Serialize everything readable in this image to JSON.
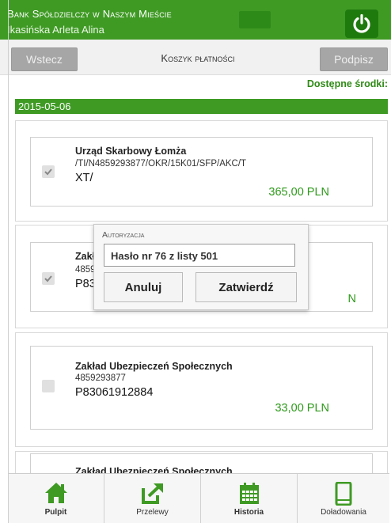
{
  "header": {
    "bank_name": "Bank Spółdzielczy w Naszym Mieście",
    "user_name": "Ikasińska Arleta Alina",
    "logout_icon": "power-icon"
  },
  "toolbar": {
    "back_label": "Wstecz",
    "title": "Koszyk płatności",
    "sign_label": "Podpisz"
  },
  "funds_label": "Dostępne środki:",
  "date": "2015-05-06",
  "payments": [
    {
      "payee": "Urząd Skarbowy Łomża",
      "account": "/TI/N4859293877/OKR/15K01/SFP/AKC/T",
      "reference": "XT/",
      "amount": "365,00 PLN",
      "checked": true
    },
    {
      "payee": "Zakła",
      "account": "4859",
      "reference": "P830",
      "amount": "N",
      "checked": true
    },
    {
      "payee": "Zakład Ubezpieczeń Społecznych",
      "account": "4859293877",
      "reference": "P83061912884",
      "amount": "33,00 PLN",
      "checked": false
    },
    {
      "payee": "Zakład Ubezpieczeń Społecznych"
    }
  ],
  "modal": {
    "title": "Autoryzacja",
    "input_value": "Hasło nr 76 z listy 501",
    "cancel_label": "Anuluj",
    "confirm_label": "Zatwierdź"
  },
  "bottom_nav": [
    {
      "label": "Pulpit",
      "icon": "home-icon"
    },
    {
      "label": "Przelewy",
      "icon": "external-link-icon"
    },
    {
      "label": "Historia",
      "icon": "calendar-icon"
    },
    {
      "label": "Doładowania",
      "icon": "phone-icon"
    }
  ],
  "colors": {
    "brand_green": "#3f9a24",
    "amount_green": "#2f9a1c"
  }
}
